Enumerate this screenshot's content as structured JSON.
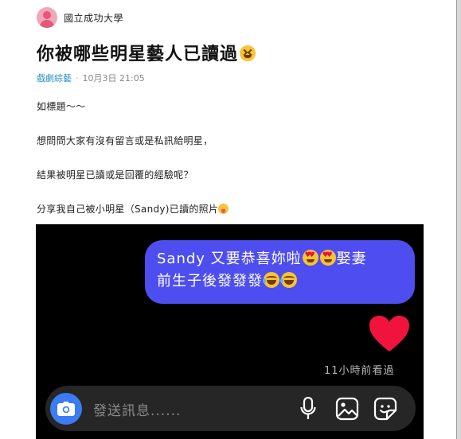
{
  "header": {
    "school": "國立成功大學",
    "avatar_icon": "female-avatar-icon"
  },
  "post": {
    "title": "你被哪些明星藝人已讀過",
    "title_emoji": "grinning-squinting-face-emoji",
    "category": "戲劇綜藝",
    "separator": "·",
    "time": "10月3日 21:05",
    "body": [
      "如標題～～",
      "想問問大家有沒有留言或是私訊給明星，",
      "結果被明星已讀或是回覆的經驗呢？",
      "分享我自己被小明星（Sandy)已讀的照片"
    ],
    "body_emoji": "face-with-tongue-emoji"
  },
  "screenshot": {
    "bubble_line1": "Sandy 又要恭喜妳啦",
    "bubble_line1_end": "娶妻",
    "bubble_line2": "前生子後發發發",
    "seen_label": "11小時前看過",
    "input_placeholder": "發送訊息......",
    "colors": {
      "bubble": "#4e4ef0",
      "heart": "#f0143c",
      "camera": "#3b7cf2",
      "background": "#000000"
    }
  }
}
